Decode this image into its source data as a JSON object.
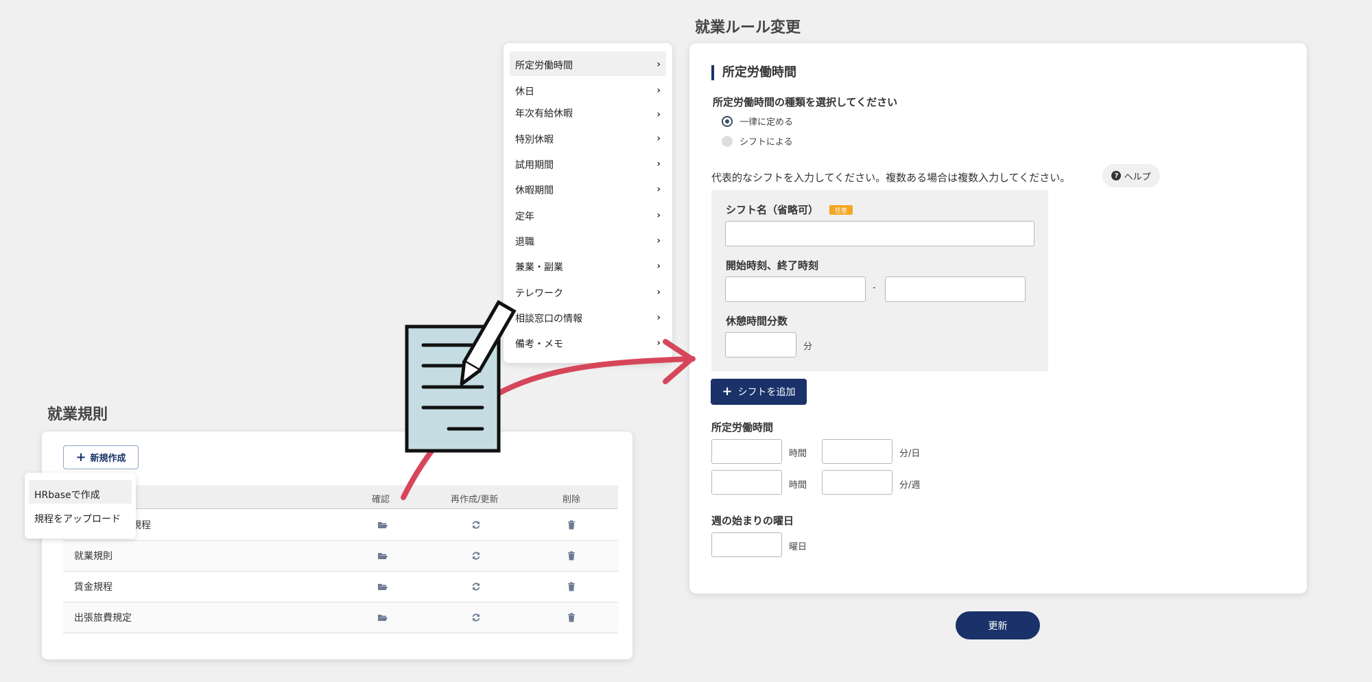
{
  "rules_panel": {
    "title": "就業規則",
    "new_button": "新規作成",
    "columns": [
      "確認",
      "再作成/更新",
      "削除"
    ],
    "rows": [
      {
        "name": "育児介護休業規程"
      },
      {
        "name": "就業規則"
      },
      {
        "name": "賃金規程"
      },
      {
        "name": "出張旅費規定"
      }
    ],
    "popup": [
      "HRbaseで作成",
      "規程をアップロード"
    ],
    "icons": {
      "view": "folder-open-icon",
      "refresh": "refresh-icon",
      "delete": "trash-icon"
    }
  },
  "side_menu": {
    "items": [
      "所定労働時間",
      "休日",
      "年次有給休暇",
      "特別休暇",
      "試用期間",
      "休暇期間",
      "定年",
      "退職",
      "兼業・副業",
      "テレワーク",
      "相談窓口の情報",
      "備考・メモ"
    ],
    "active_index": 0
  },
  "form": {
    "page_title": "就業ルール変更",
    "section_title": "所定労働時間",
    "type_question": "所定労働時間の種類を選択してください",
    "options": [
      {
        "label": "一律に定める",
        "selected": true
      },
      {
        "label": "シフトによる",
        "selected": false
      }
    ],
    "shift_prompt": "代表的なシフトを入力してください。複数ある場合は複数入力してください。",
    "help": "ヘルプ",
    "shift_name_label": "シフト名（省略可）",
    "optional_badge": "任意",
    "time_label": "開始時刻、終了時刻",
    "dash": "-",
    "break_label": "休憩時間分数",
    "minute_unit": "分",
    "add_shift": "シフトを追加",
    "hours_label": "所定労働時間",
    "hour_unit": "時間",
    "min_per_day": "分/日",
    "min_per_week": "分/週",
    "week_start_label": "週の始まりの曜日",
    "weekday_unit": "曜日",
    "update": "更新"
  },
  "colors": {
    "primary": "#1a3269",
    "accent_arrow": "#d6465a",
    "badge": "#f5a623"
  }
}
